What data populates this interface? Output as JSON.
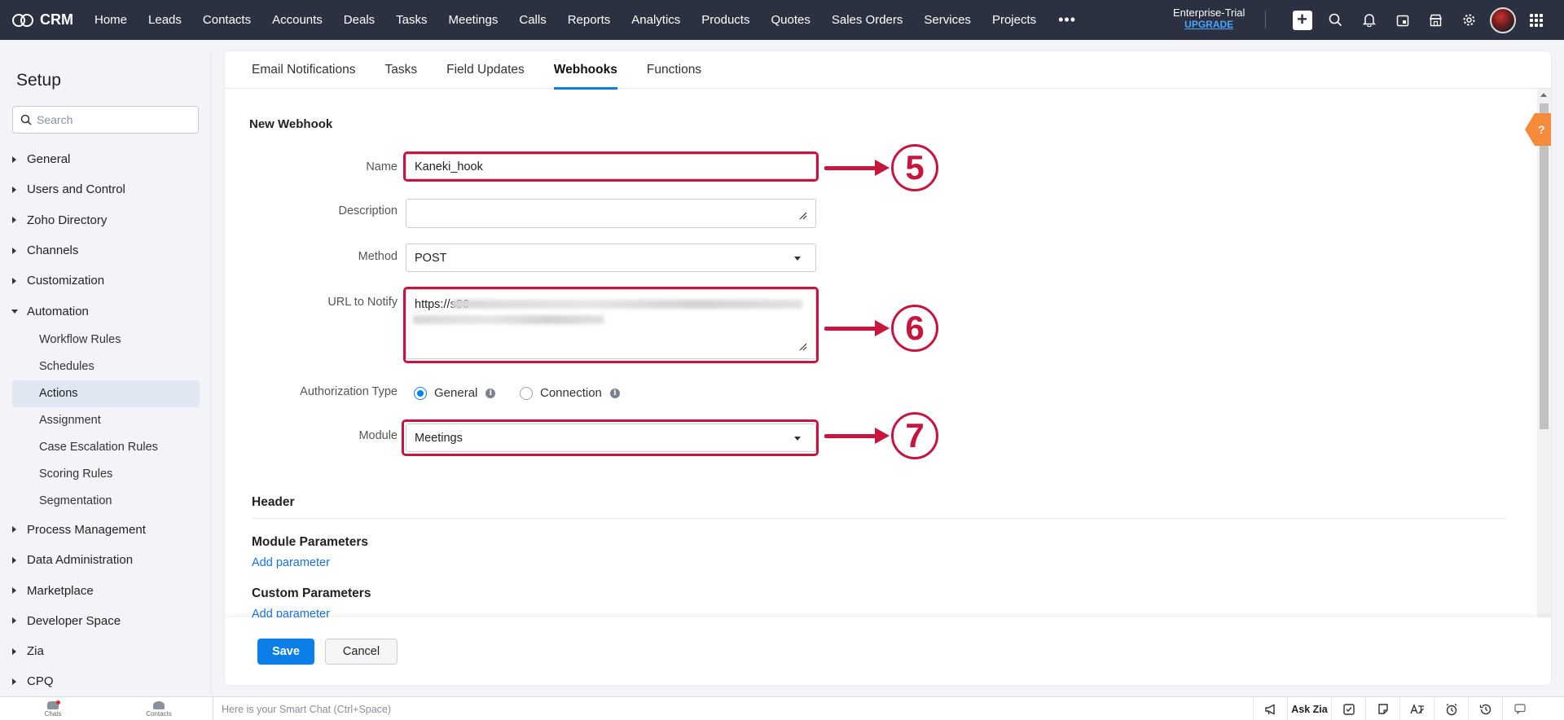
{
  "topnav": {
    "brand": "CRM",
    "items": [
      "Home",
      "Leads",
      "Contacts",
      "Accounts",
      "Deals",
      "Tasks",
      "Meetings",
      "Calls",
      "Reports",
      "Analytics",
      "Products",
      "Quotes",
      "Sales Orders",
      "Services",
      "Projects"
    ],
    "more": "•••",
    "trial_label": "Enterprise-Trial",
    "upgrade_label": "UPGRADE",
    "icons": [
      "plus-icon",
      "search-icon",
      "bell-icon",
      "calendar-icon",
      "marketplace-icon",
      "gear-icon",
      "avatar",
      "apps-grid-icon"
    ],
    "background": "#2b3140"
  },
  "sidebar": {
    "title": "Setup",
    "search_placeholder": "Search",
    "sections_before": [
      "General",
      "Users and Control",
      "Zoho Directory",
      "Channels",
      "Customization"
    ],
    "open_section": "Automation",
    "sub_items": [
      "Workflow Rules",
      "Schedules",
      "Actions",
      "Assignment",
      "Case Escalation Rules",
      "Scoring Rules",
      "Segmentation"
    ],
    "active_sub_item": "Actions",
    "sections_after": [
      "Process Management",
      "Data Administration",
      "Marketplace",
      "Developer Space",
      "Zia",
      "CPQ"
    ]
  },
  "tabs": {
    "items": [
      "Email Notifications",
      "Tasks",
      "Field Updates",
      "Webhooks",
      "Functions"
    ],
    "active": "Webhooks"
  },
  "form": {
    "title": "New Webhook",
    "name_label": "Name",
    "name_value": "Kaneki_hook",
    "description_label": "Description",
    "description_value": "",
    "method_label": "Method",
    "method_value": "POST",
    "url_label": "URL to Notify",
    "url_value": "https://s86",
    "auth_label": "Authorization Type",
    "auth_options": [
      "General",
      "Connection"
    ],
    "auth_selected": "General",
    "module_label": "Module",
    "module_value": "Meetings"
  },
  "annotations": {
    "step5": "5",
    "step6": "6",
    "step7": "7",
    "color": "#c8153e"
  },
  "sections": {
    "header": "Header",
    "module_params": "Module Parameters",
    "module_params_link": "Add parameter",
    "custom_params": "Custom Parameters",
    "custom_params_link": "Add parameter"
  },
  "footer": {
    "save": "Save",
    "cancel": "Cancel"
  },
  "bottombar": {
    "chats": "Chats",
    "contacts": "Contacts",
    "smart_chat": "Here is your Smart Chat (Ctrl+Space)",
    "ask_zia": "Ask Zia"
  },
  "colors": {
    "accent": "#0b7ee8",
    "link": "#1473e6"
  }
}
